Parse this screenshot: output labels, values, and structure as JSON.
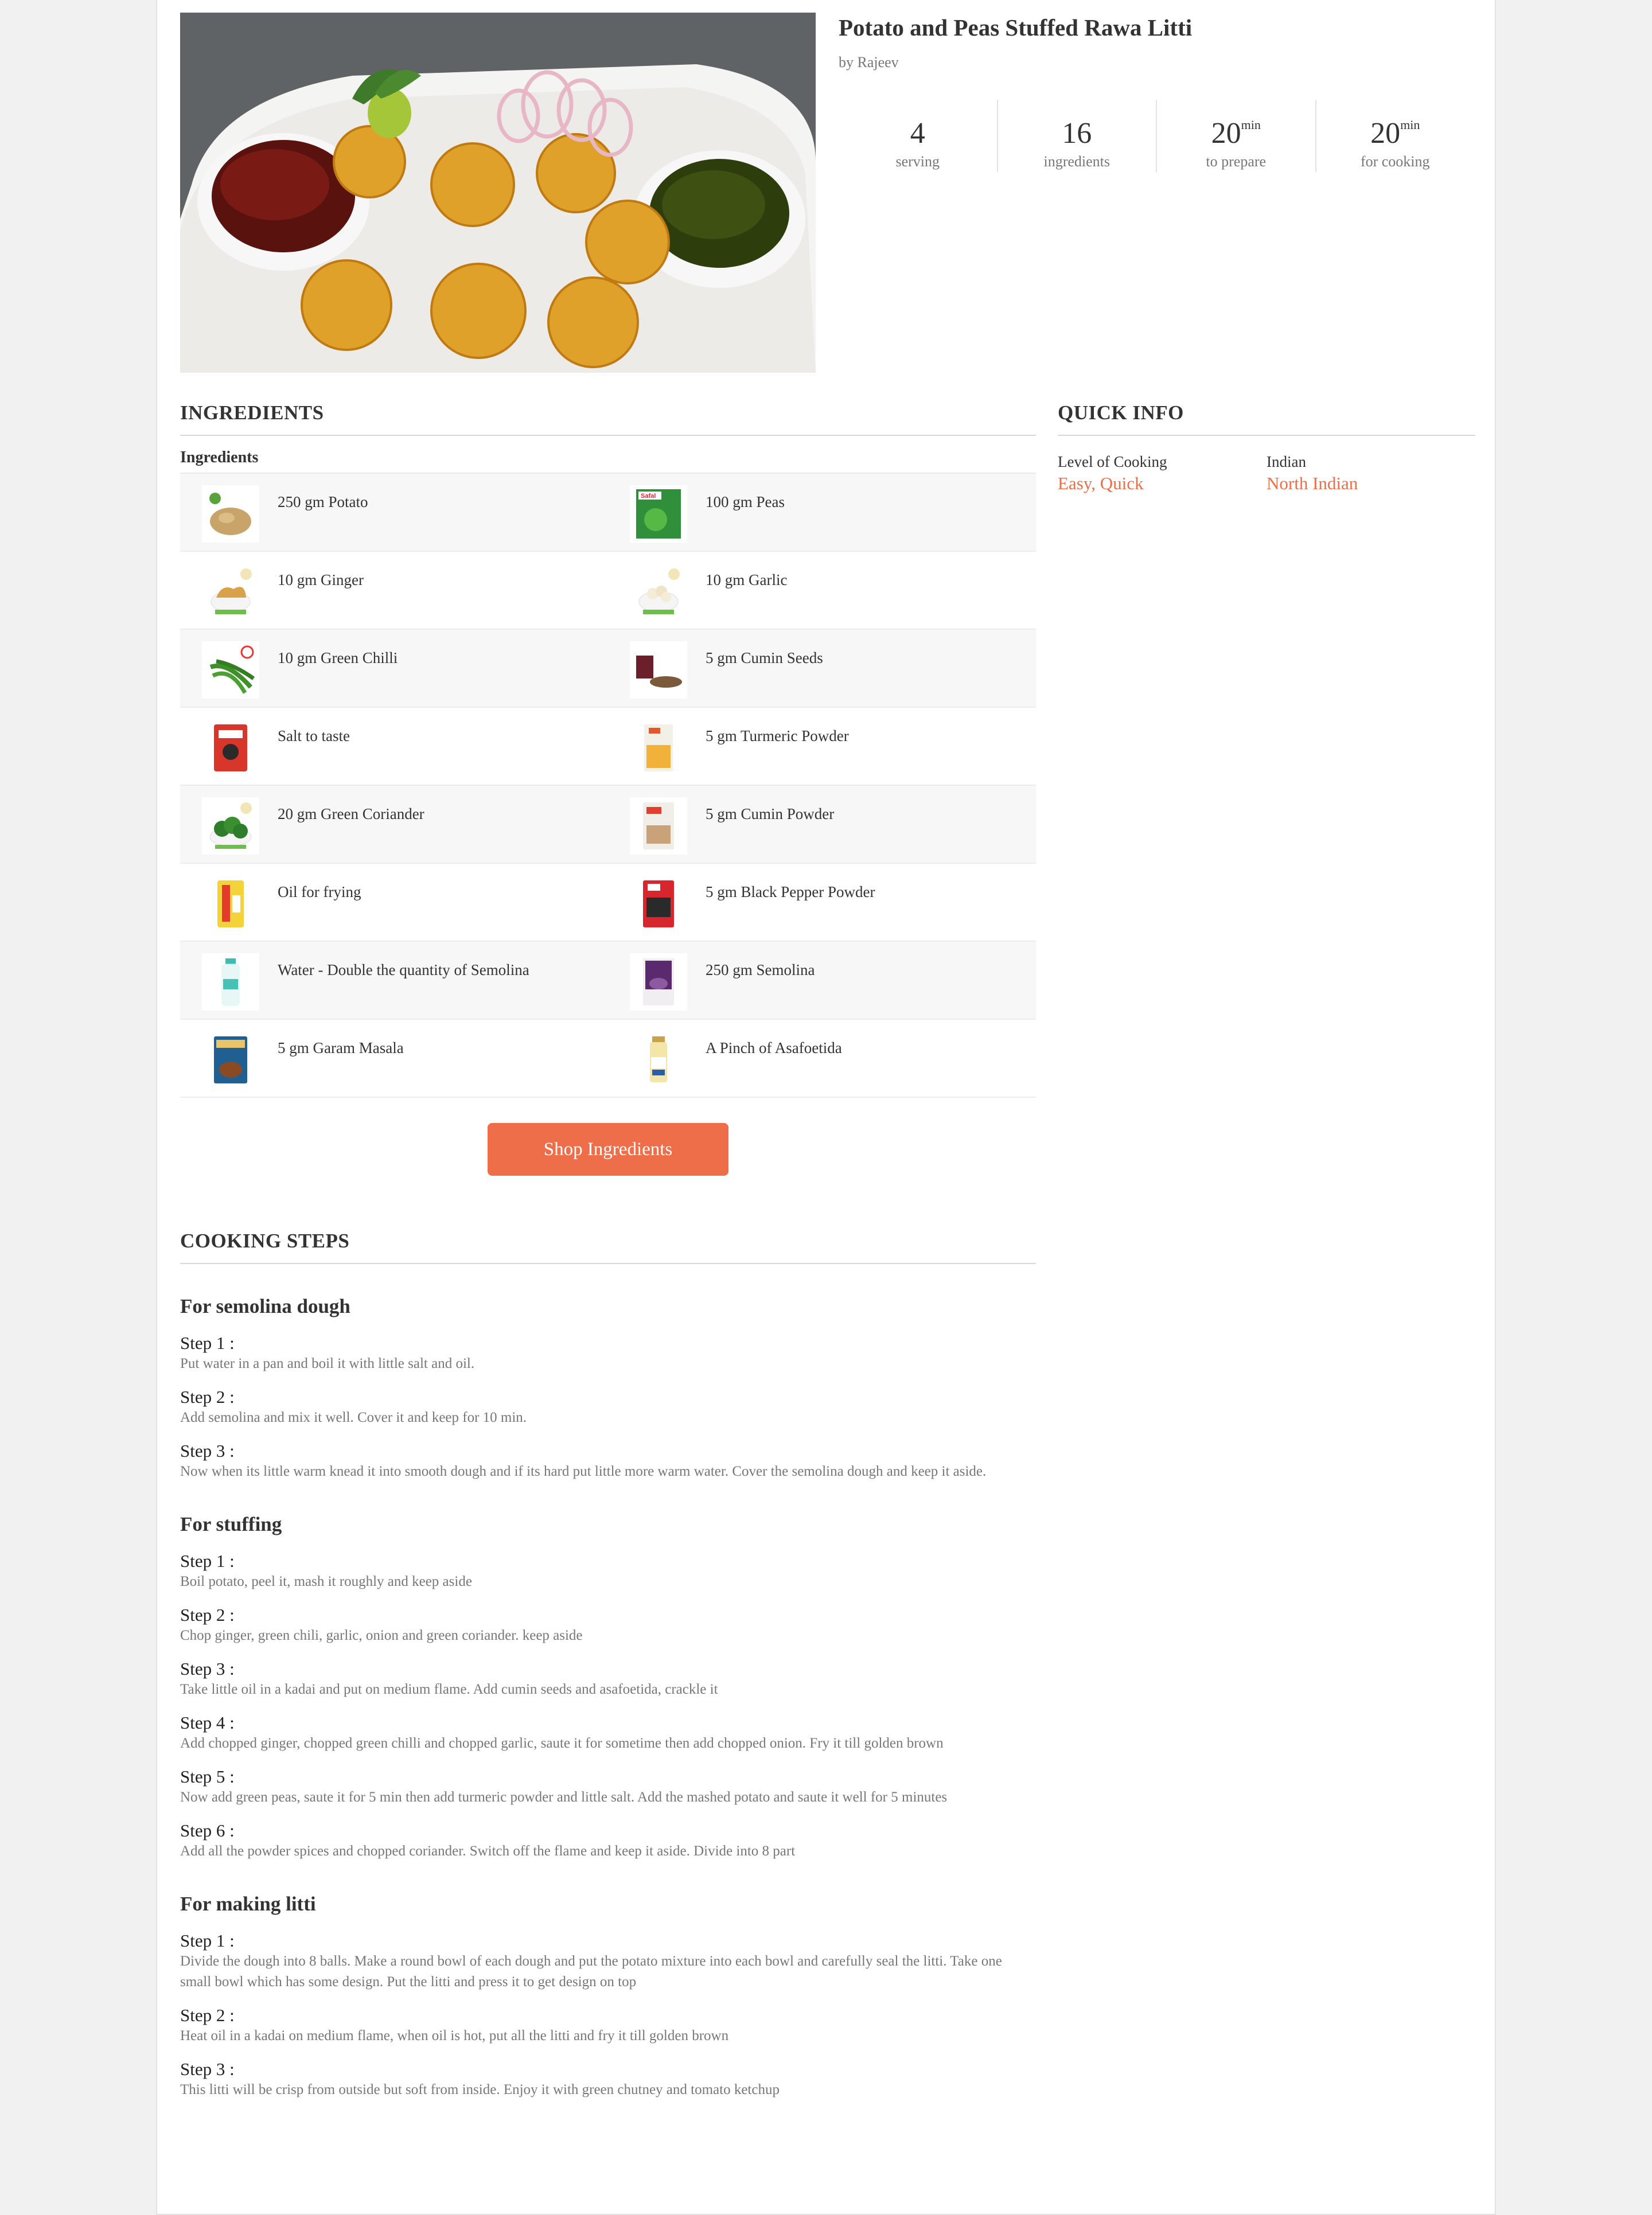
{
  "recipe": {
    "title": "Potato and Peas Stuffed Rawa Litti",
    "author": "by Rajeev",
    "stats": [
      {
        "num": "4",
        "unit": "",
        "label": "serving"
      },
      {
        "num": "16",
        "unit": "",
        "label": "ingredients"
      },
      {
        "num": "20",
        "unit": "min",
        "label": "to prepare"
      },
      {
        "num": "20",
        "unit": "min",
        "label": "for cooking"
      }
    ]
  },
  "ingredients": {
    "heading": "INGREDIENTS",
    "subheading": "Ingredients",
    "rows": [
      [
        {
          "text": "250 gm Potato",
          "icon": "potato-icon"
        },
        {
          "text": "100 gm Peas",
          "icon": "peas-pack-icon"
        }
      ],
      [
        {
          "text": "10 gm Ginger",
          "icon": "ginger-icon"
        },
        {
          "text": "10 gm Garlic",
          "icon": "garlic-icon"
        }
      ],
      [
        {
          "text": "10 gm Green Chilli",
          "icon": "green-chilli-icon"
        },
        {
          "text": "5 gm Cumin Seeds",
          "icon": "cumin-seeds-icon"
        }
      ],
      [
        {
          "text": "Salt to taste",
          "icon": "salt-pack-icon"
        },
        {
          "text": "5 gm Turmeric Powder",
          "icon": "turmeric-pack-icon"
        }
      ],
      [
        {
          "text": "20 gm Green Coriander",
          "icon": "coriander-icon"
        },
        {
          "text": "5 gm Cumin Powder",
          "icon": "cumin-powder-pack-icon"
        }
      ],
      [
        {
          "text": "Oil for frying",
          "icon": "oil-pack-icon"
        },
        {
          "text": "5 gm Black Pepper Powder",
          "icon": "pepper-pack-icon"
        }
      ],
      [
        {
          "text": "Water - Double the quantity of Semolina",
          "icon": "water-bottle-icon"
        },
        {
          "text": "250 gm Semolina",
          "icon": "semolina-pack-icon"
        }
      ],
      [
        {
          "text": "5 gm Garam Masala",
          "icon": "garam-masala-box-icon"
        },
        {
          "text": "A Pinch of Asafoetida",
          "icon": "asafoetida-jar-icon"
        }
      ]
    ],
    "shop_button": "Shop Ingredients"
  },
  "quick_info": {
    "heading": "QUICK INFO",
    "items": [
      {
        "label": "Level of Cooking",
        "value": "Easy, Quick"
      },
      {
        "label": "Indian",
        "value": "North Indian"
      }
    ]
  },
  "cooking_steps": {
    "heading": "COOKING STEPS",
    "groups": [
      {
        "title": "For semolina dough",
        "steps": [
          {
            "label": "Step 1 :",
            "text": "Put water in a pan and boil it with little salt and oil."
          },
          {
            "label": "Step 2 :",
            "text": "Add semolina and mix it well. Cover it and keep for 10 min."
          },
          {
            "label": "Step 3 :",
            "text": "Now when its little warm knead it into smooth dough and if its hard put little more warm water. Cover the semolina dough and keep it aside."
          }
        ]
      },
      {
        "title": "For stuffing",
        "steps": [
          {
            "label": "Step 1 :",
            "text": "Boil potato, peel it, mash it roughly and keep aside"
          },
          {
            "label": "Step 2 :",
            "text": "Chop ginger, green chili, garlic, onion and green coriander. keep aside"
          },
          {
            "label": "Step 3 :",
            "text": "Take little oil in a kadai and put on medium flame. Add cumin seeds and asafoetida, crackle it"
          },
          {
            "label": "Step 4 :",
            "text": "Add chopped ginger, chopped green chilli and chopped garlic, saute it for sometime then add chopped onion. Fry it till golden brown"
          },
          {
            "label": "Step 5 :",
            "text": "Now add green peas, saute it for 5 min then add turmeric powder and little salt. Add the mashed potato and saute it well for 5 minutes"
          },
          {
            "label": "Step 6 :",
            "text": "Add all the powder spices and chopped coriander. Switch off the flame and keep it aside. Divide into 8 part"
          }
        ]
      },
      {
        "title": "For making litti",
        "steps": [
          {
            "label": "Step 1 :",
            "text": "Divide the dough into 8 balls. Make a round bowl of each dough and put the potato mixture into each bowl and carefully seal the litti. Take one small bowl which has some design. Put the litti and press it to get design on top"
          },
          {
            "label": "Step 2 :",
            "text": "Heat oil in a kadai on medium flame, when oil is hot, put all the litti and fry it till golden brown"
          },
          {
            "label": "Step 3 :",
            "text": "This litti will be crisp from outside but soft from inside. Enjoy it with green chutney and tomato ketchup"
          }
        ]
      }
    ]
  },
  "colors": {
    "accent": "#ee6e4a",
    "page_bg": "#f1f1f1"
  }
}
